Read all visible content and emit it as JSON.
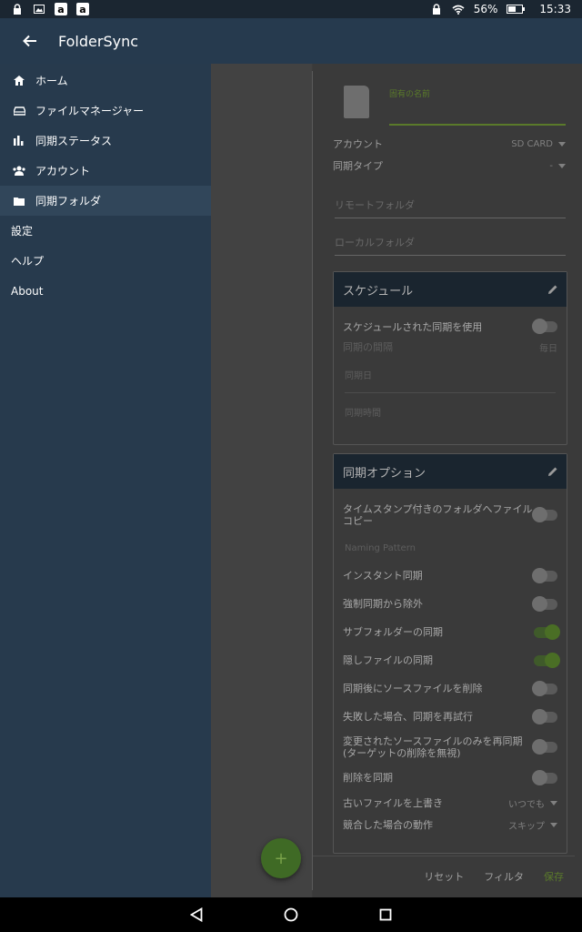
{
  "status_bar": {
    "battery": "56%",
    "time": "15:33",
    "amazon_icon_letter": "a"
  },
  "toolbar": {
    "title": "FolderSync"
  },
  "drawer": {
    "items": [
      {
        "label": "ホーム",
        "icon": "home-icon"
      },
      {
        "label": "ファイルマネージャー",
        "icon": "drive-icon"
      },
      {
        "label": "同期ステータス",
        "icon": "bar-chart-icon"
      },
      {
        "label": "アカウント",
        "icon": "accounts-icon"
      },
      {
        "label": "同期フォルダ",
        "icon": "folder-icon"
      }
    ],
    "settings": "設定",
    "help": "ヘルプ",
    "about": "About"
  },
  "form": {
    "name_label": "固有の名前",
    "account_label": "アカウント",
    "account_value": "SD CARD",
    "sync_type_label": "同期タイプ",
    "sync_type_value": "-",
    "remote_folder_placeholder": "リモートフォルダ",
    "local_folder_placeholder": "ローカルフォルダ"
  },
  "schedule": {
    "title": "スケジュール",
    "use_scheduled": "スケジュールされた同期を使用",
    "interval_label": "同期の間隔",
    "interval_value": "毎日",
    "sync_day": "同期日",
    "sync_time": "同期時間"
  },
  "options": {
    "title": "同期オプション",
    "timestamp_copy": "タイムスタンプ付きのフォルダへファイルコピー",
    "naming_pattern": "Naming Pattern",
    "instant_sync": "インスタント同期",
    "exclude_forced": "強制同期から除外",
    "subfolder_sync": "サブフォルダーの同期",
    "hidden_files": "隠しファイルの同期",
    "delete_source": "同期後にソースファイルを削除",
    "retry_failed": "失敗した場合、同期を再試行",
    "only_changed": "変更されたソースファイルのみを再同期(ターゲットの削除を無視)",
    "sync_deletions": "削除を同期",
    "overwrite_label": "古いファイルを上書き",
    "overwrite_value": "いつでも",
    "conflict_label": "競合した場合の動作",
    "conflict_value": "スキップ"
  },
  "toggles": {
    "timestamp_copy": 0,
    "instant_sync": 0,
    "exclude_forced": 0,
    "subfolder_sync": 1,
    "hidden_files": 1,
    "delete_source": 0,
    "retry_failed": 0,
    "only_changed": 0,
    "sync_deletions": 0,
    "use_scheduled": 0
  },
  "buttons": {
    "reset": "リセット",
    "filter": "フィルタ",
    "save": "保存",
    "fab": "+"
  },
  "colors": {
    "accent": "#4a6e25",
    "drawer_bg": "#273a4d",
    "toolbar_bg": "#263a4e"
  }
}
